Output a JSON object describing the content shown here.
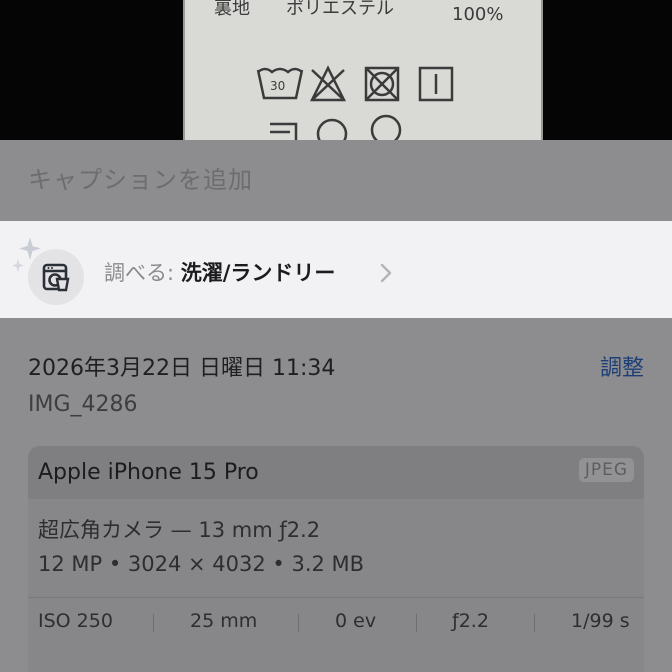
{
  "photo": {
    "label_text_left": "裏地",
    "label_text_mid": "ポリエステル",
    "label_text_right": "100%",
    "wash_temp": "30"
  },
  "caption": {
    "placeholder": "キャプションを追加"
  },
  "lookup": {
    "prefix": "調べる: ",
    "subject": "洗濯/ランドリー",
    "icon": "laundry-icon"
  },
  "details": {
    "date": "2026年3月22日 日曜日 11:34",
    "adjust_label": "調整",
    "filename": "IMG_4286"
  },
  "camera": {
    "device": "Apple iPhone 15 Pro",
    "format": "JPEG",
    "lens": "超広角カメラ — 13 mm ƒ2.2",
    "specs": "12 MP • 3024 × 4032 • 3.2 MB",
    "exif": {
      "iso": "ISO 250",
      "focal": "25 mm",
      "ev": "0 ev",
      "aperture": "ƒ2.2",
      "shutter": "1/99 s"
    }
  }
}
